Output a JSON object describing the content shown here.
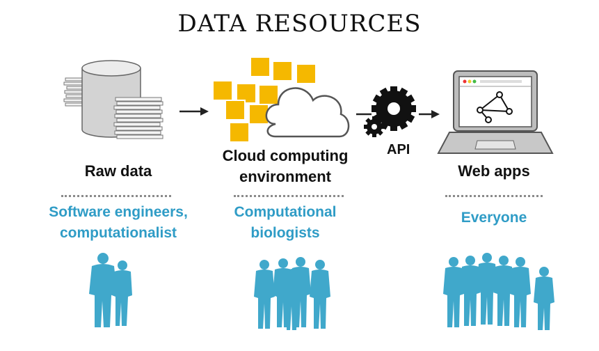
{
  "title": "DATA RESOURCES",
  "stages": [
    {
      "label": "Raw data",
      "audience": "Software engineers,\ncomputationalist"
    },
    {
      "label": "Cloud computing\nenvironment",
      "audience": "Computational\nbiologists"
    },
    {
      "label": "Web apps",
      "audience": "Everyone"
    }
  ],
  "connector_label": "API",
  "colors": {
    "people": "#40a8cb",
    "audience_text": "#2f9cc6",
    "cubes": "#f5b800",
    "laptop": "#b9b9b9"
  }
}
